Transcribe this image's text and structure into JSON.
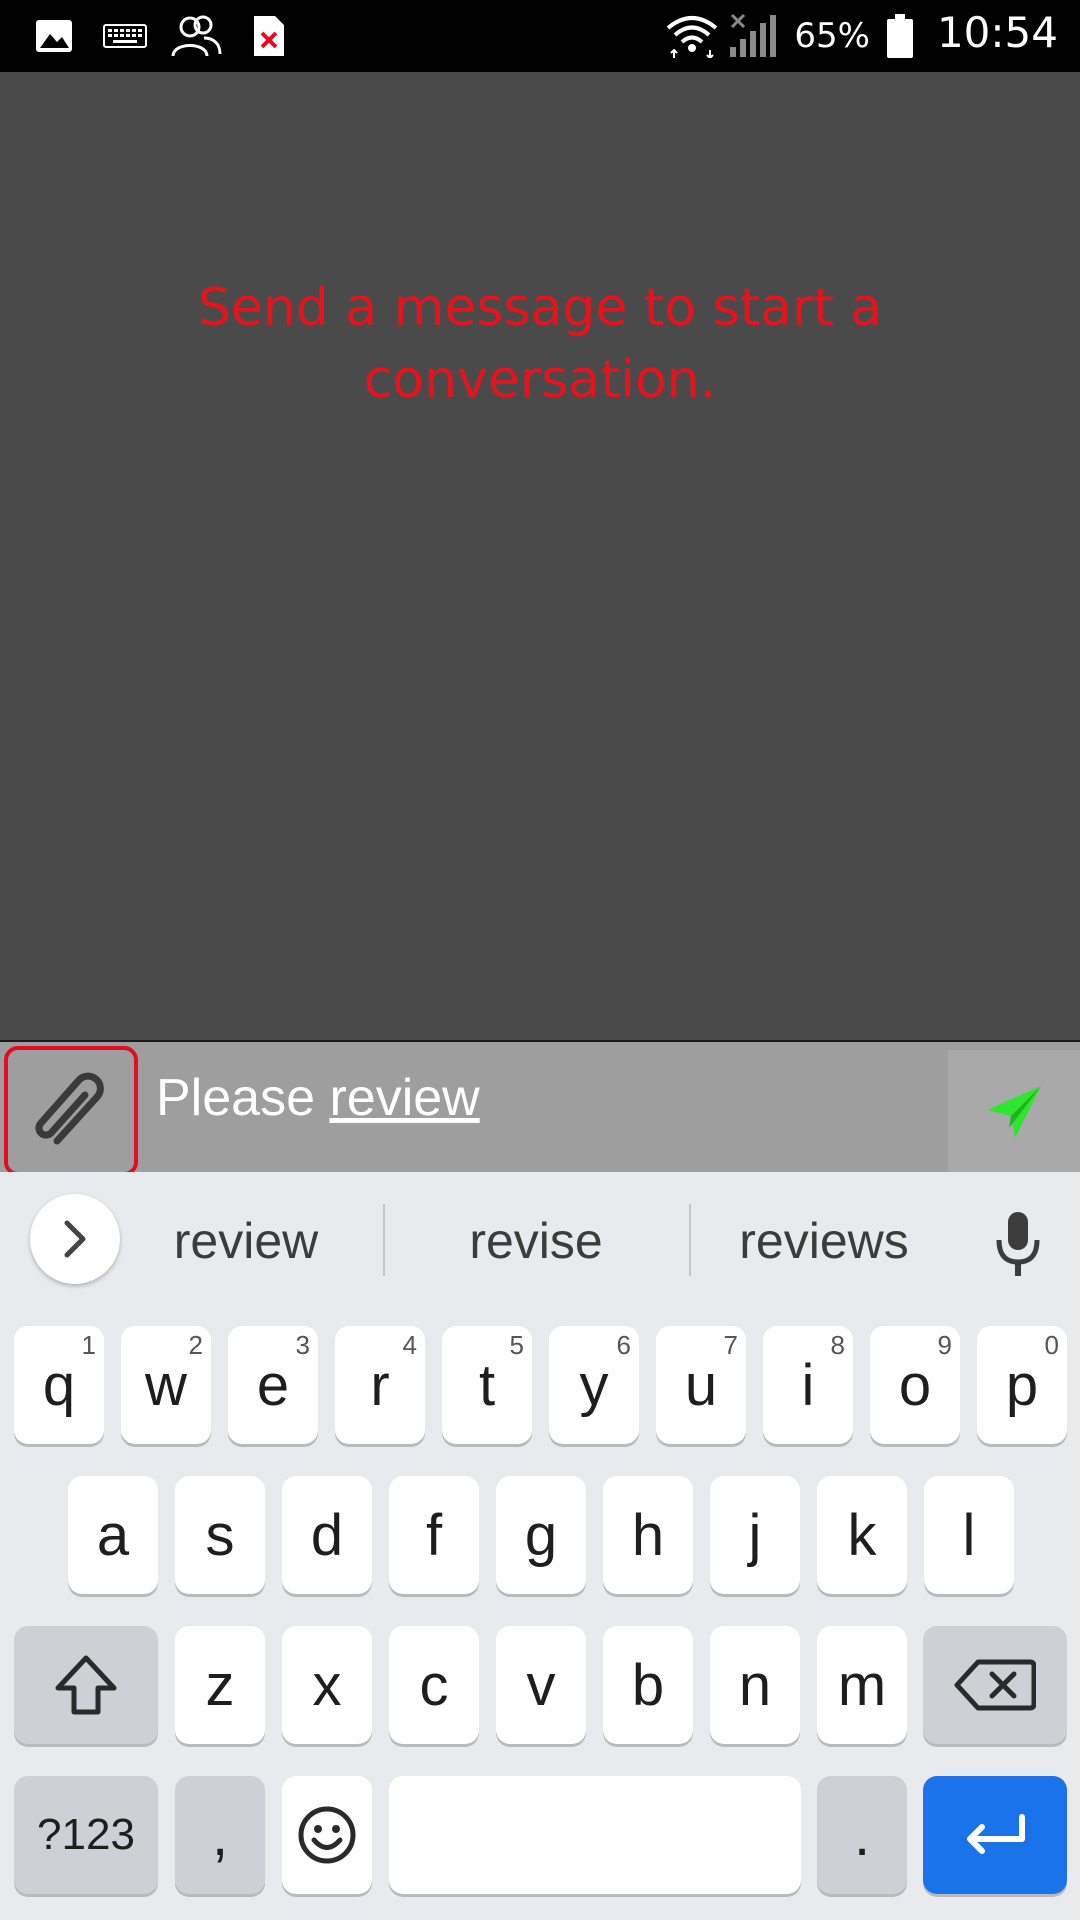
{
  "status_bar": {
    "battery_pct": "65%",
    "time": "10:54"
  },
  "chat": {
    "empty_message": "Send a message to start a conversation."
  },
  "compose": {
    "text_plain": "Please ",
    "text_underlined": "review"
  },
  "suggestions": [
    "review",
    "revise",
    "reviews"
  ],
  "keyboard": {
    "row1": [
      {
        "letter": "q",
        "num": "1"
      },
      {
        "letter": "w",
        "num": "2"
      },
      {
        "letter": "e",
        "num": "3"
      },
      {
        "letter": "r",
        "num": "4"
      },
      {
        "letter": "t",
        "num": "5"
      },
      {
        "letter": "y",
        "num": "6"
      },
      {
        "letter": "u",
        "num": "7"
      },
      {
        "letter": "i",
        "num": "8"
      },
      {
        "letter": "o",
        "num": "9"
      },
      {
        "letter": "p",
        "num": "0"
      }
    ],
    "row2": [
      "a",
      "s",
      "d",
      "f",
      "g",
      "h",
      "j",
      "k",
      "l"
    ],
    "row3": [
      "z",
      "x",
      "c",
      "v",
      "b",
      "n",
      "m"
    ],
    "symbols_label": "?123",
    "comma": ",",
    "period": "."
  },
  "colors": {
    "empty_message": "#e5141c",
    "attach_highlight": "#e30d21",
    "send_icon": "#2ee62e",
    "enter_key": "#1a73e8"
  }
}
